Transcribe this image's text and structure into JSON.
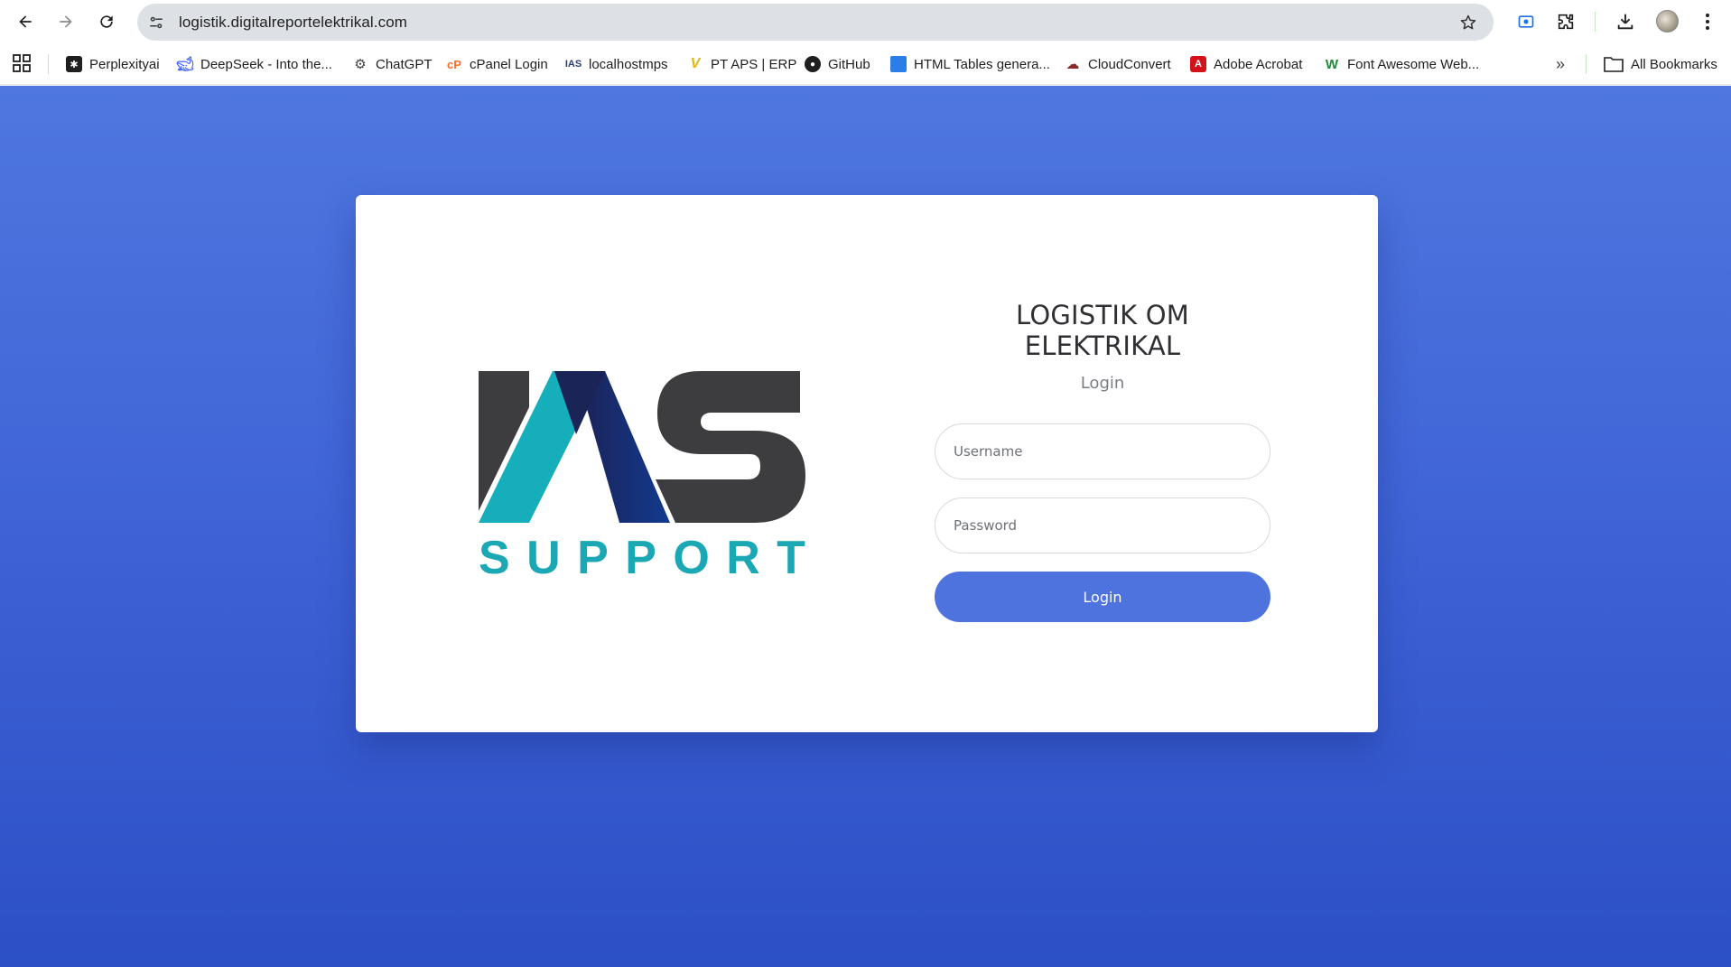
{
  "browser": {
    "url": "logistik.digitalreportelektrikal.com",
    "bookmarks": [
      {
        "label": "Perplexityai",
        "icon": "perplexity-icon"
      },
      {
        "label": "DeepSeek - Into the...",
        "icon": "deepseek-icon"
      },
      {
        "label": "ChatGPT",
        "icon": "chatgpt-icon"
      },
      {
        "label": "cPanel Login",
        "icon": "cpanel-icon"
      },
      {
        "label": "localhostmps",
        "icon": "ias-icon"
      },
      {
        "label": "PT APS | ERP",
        "icon": "aps-icon"
      },
      {
        "label": "GitHub",
        "icon": "github-icon"
      },
      {
        "label": "HTML Tables genera...",
        "icon": "table-icon"
      },
      {
        "label": "CloudConvert",
        "icon": "cloud-icon"
      },
      {
        "label": "Adobe Acrobat",
        "icon": "acrobat-icon"
      },
      {
        "label": "Font Awesome Web...",
        "icon": "fontawesome-icon"
      }
    ],
    "all_bookmarks_label": "All Bookmarks"
  },
  "page": {
    "logo_text": "SUPPORT",
    "title": "LOGISTIK OM ELEKTRIKAL",
    "subtitle": "Login",
    "username_placeholder": "Username",
    "password_placeholder": "Password",
    "login_button": "Login"
  },
  "colors": {
    "background_top": "#4f77df",
    "background_bottom": "#2c4fc6",
    "button": "#4e73df",
    "logo_teal": "#1ba7b4",
    "logo_dark": "#3d3d3f",
    "logo_navy": "#1f2d6e"
  }
}
